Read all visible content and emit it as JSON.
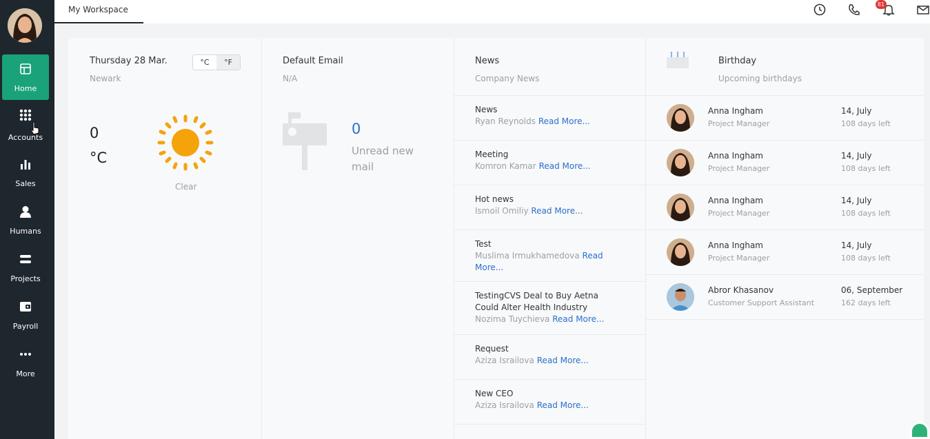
{
  "sidebar": {
    "items": [
      {
        "label": "Home",
        "icon": "home-icon"
      },
      {
        "label": "Accounts",
        "icon": "grid-icon"
      },
      {
        "label": "Sales",
        "icon": "bar-chart-icon"
      },
      {
        "label": "Humans",
        "icon": "person-icon"
      },
      {
        "label": "Projects",
        "icon": "stack-icon"
      },
      {
        "label": "Payroll",
        "icon": "wallet-icon"
      },
      {
        "label": "More",
        "icon": "more-dots-icon"
      }
    ]
  },
  "topbar": {
    "tab_label": "My Workspace",
    "notification_count": "81"
  },
  "weather": {
    "date": "Thursday 28 Mar.",
    "city": "Newark",
    "unit_c": "°C",
    "unit_f": "°F",
    "temp": "0",
    "temp_unit": "°C",
    "condition": "Clear"
  },
  "email": {
    "title": "Default Email",
    "address": "N/A",
    "unread_count": "0",
    "unread_label": "Unread new mail"
  },
  "news": {
    "title": "News",
    "subtitle": "Company News",
    "read_more": "Read More...",
    "items": [
      {
        "title": "News",
        "author": "Ryan Reynolds"
      },
      {
        "title": "Meeting",
        "author": "Komron Kamar"
      },
      {
        "title": "Hot news",
        "author": "Ismoil Omiliy"
      },
      {
        "title": "Test",
        "author": "Muslima Irmukhamedova"
      },
      {
        "title": "TestingCVS Deal to Buy Aetna Could Alter Health Industry",
        "author": "Nozima Tuychieva"
      },
      {
        "title": "Request",
        "author": "Aziza Israilova"
      },
      {
        "title": "New CEO",
        "author": "Aziza Israilova"
      }
    ]
  },
  "birthday": {
    "title": "Birthday",
    "subtitle": "Upcoming birthdays",
    "people": [
      {
        "name": "Anna Ingham",
        "role": "Project Manager",
        "date": "14, July",
        "days_left": "108 days left"
      },
      {
        "name": "Anna Ingham",
        "role": "Project Manager",
        "date": "14, July",
        "days_left": "108 days left"
      },
      {
        "name": "Anna Ingham",
        "role": "Project Manager",
        "date": "14, July",
        "days_left": "108 days left"
      },
      {
        "name": "Anna Ingham",
        "role": "Project Manager",
        "date": "14, July",
        "days_left": "108 days left"
      },
      {
        "name": "Abror Khasanov",
        "role": "Customer Support Assistant",
        "date": "06, September",
        "days_left": "162 days left"
      }
    ]
  },
  "colors": {
    "sidebar_bg": "#1f272e",
    "active_green": "#1aa37a",
    "link_blue": "#2b6fcc",
    "sun_orange": "#f5a30a",
    "badge_red": "#e03535"
  }
}
